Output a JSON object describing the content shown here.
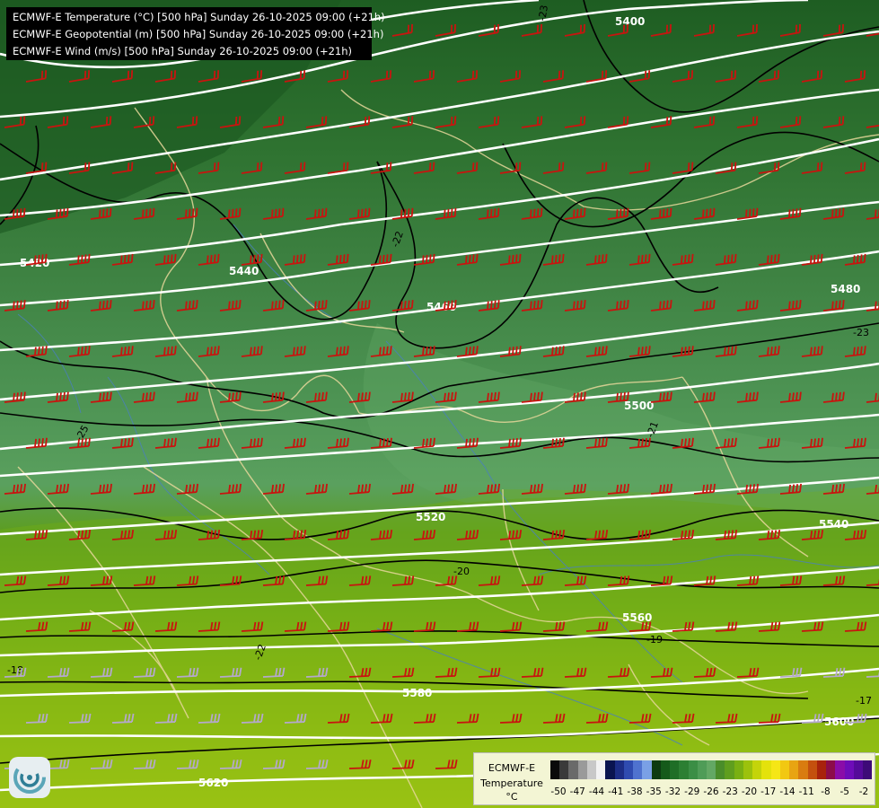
{
  "header": {
    "line1": "ECMWF-E Temperature (°C) [500 hPa] Sunday 26-10-2025 09:00 (+21h)",
    "line2": "ECMWF-E Geopotential (m) [500 hPa] Sunday 26-10-2025 09:00 (+21h)",
    "line3": "ECMWF-E Wind (m/s) [500 hPa] Sunday 26-10-2025 09:00 (+21h)"
  },
  "geopotential_labels": [
    "5400",
    "5420",
    "5440",
    "5460",
    "5480",
    "5500",
    "5520",
    "5540",
    "5560",
    "5580",
    "5600",
    "5620"
  ],
  "temperature_labels": [
    "-23",
    "-22",
    "-21",
    "-20",
    "-19",
    "-18",
    "-17",
    "-23",
    "-25",
    "-22"
  ],
  "legend": {
    "title1": "ECMWF-E",
    "title2": "Temperature",
    "unit": "°C",
    "ticks": [
      "-50",
      "-47",
      "-44",
      "-41",
      "-38",
      "-35",
      "-32",
      "-29",
      "-26",
      "-23",
      "-20",
      "-17",
      "-14",
      "-11",
      "-8",
      "-5",
      "-2"
    ],
    "colors": [
      "#0a0a0a",
      "#3a3a3a",
      "#6a6a6a",
      "#9a9a9a",
      "#c8c8c8",
      "#f2f2f2",
      "#0a1450",
      "#1c2d86",
      "#2f4bb0",
      "#4f72cf",
      "#7aa0e6",
      "#0d3b12",
      "#155a1a",
      "#1f6e26",
      "#2c7f33",
      "#3b8e45",
      "#4f9c57",
      "#63a864",
      "#4a8d2a",
      "#5f9e1e",
      "#79b012",
      "#9cc20c",
      "#c4d40a",
      "#e4e20c",
      "#f5e616",
      "#f2c812",
      "#e8a412",
      "#d97c10",
      "#c4500e",
      "#a8220c",
      "#8c0c4a",
      "#8a0ca8",
      "#6e0cb8",
      "#550a9a",
      "#3d0a78"
    ]
  },
  "colors": {
    "wind_barb": "#c8140f",
    "wind_barb_light": "#b4a8cc",
    "geopotential_line": "#ffffff",
    "temperature_line": "#000000",
    "borders": "#e6d79a",
    "rivers": "#4a7fbf"
  },
  "logo_icon": "ecmwf-swirl-icon"
}
